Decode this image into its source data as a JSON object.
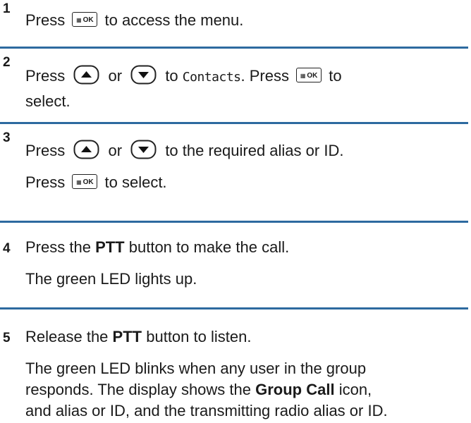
{
  "steps": [
    {
      "number": "1",
      "parts": {
        "a": "Press",
        "b": "to access the menu."
      }
    },
    {
      "number": "2",
      "parts": {
        "a": "Press",
        "or": "or",
        "b": "to",
        "menu_item": "Contacts",
        "c": ". Press",
        "d": "to",
        "e": "select."
      }
    },
    {
      "number": "3",
      "parts": {
        "a": "Press",
        "or": "or",
        "b": "to the required alias or ID.",
        "c": "Press",
        "d": "to select."
      }
    },
    {
      "number": "4",
      "parts": {
        "a": "Press the",
        "bold": "PTT",
        "b": "button to make the call.",
        "c": "The green LED lights up."
      }
    },
    {
      "number": "5",
      "parts": {
        "a": "Release the",
        "bold": "PTT",
        "b": "button to listen.",
        "c": "The green LED blinks when any user in the group",
        "d": "responds. The display shows the",
        "bold2": "Group Call",
        "e": "icon,",
        "f": "and alias or ID, and the transmitting radio alias or ID."
      }
    }
  ],
  "keys": {
    "ok_label": "OK",
    "ok_glyph": "▦",
    "up_icon": "up-arrow-key-icon",
    "down_icon": "down-arrow-key-icon"
  },
  "colors": {
    "separator": "#2d6a9f"
  }
}
